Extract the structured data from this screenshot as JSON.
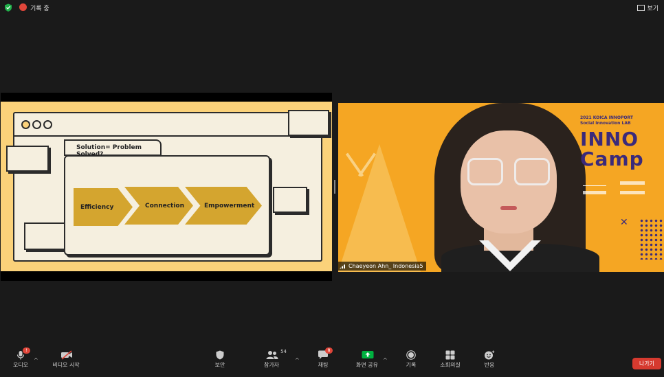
{
  "topbar": {
    "recording_label": "기록 중",
    "view_label": "보기"
  },
  "slide": {
    "tab_title": "Solution= Problem Solved?",
    "steps": [
      "Efficiency",
      "Connection",
      "Empowerment"
    ]
  },
  "video": {
    "participant_name": "Chaeyeon Ahn_ Indonesia5",
    "banner": {
      "subtitle_line1": "2021 KOICA INNOPORT",
      "subtitle_line2": "Social Innovation LAB",
      "title_line1": "INNO",
      "title_line2": "Camp"
    }
  },
  "toolbar": {
    "audio": {
      "label": "오디오",
      "badge": "!"
    },
    "video": {
      "label": "비디오 시작"
    },
    "security": {
      "label": "보안"
    },
    "participants": {
      "label": "참가자",
      "count": "54"
    },
    "chat": {
      "label": "채팅",
      "badge": "8"
    },
    "share": {
      "label": "화면 공유"
    },
    "record": {
      "label": "기록"
    },
    "breakout": {
      "label": "소회의실"
    },
    "reactions": {
      "label": "반응"
    },
    "leave": {
      "label": "나가기"
    }
  },
  "colors": {
    "accent_green": "#00b140",
    "leave_red": "#d63a2f",
    "slide_yellow": "#fbd27a",
    "arrow_gold": "#d4a52f",
    "banner_purple": "#3b2a7a"
  }
}
